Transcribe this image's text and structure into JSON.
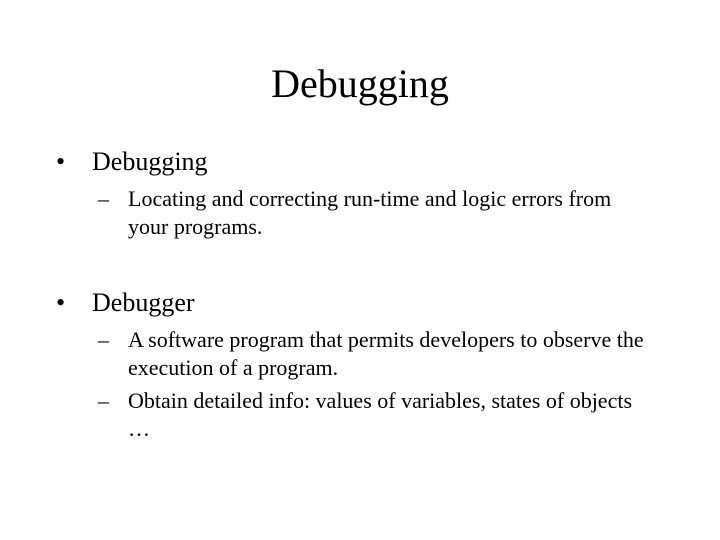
{
  "title": "Debugging",
  "sections": [
    {
      "heading": "Debugging",
      "items": [
        "Locating and correcting run-time and logic errors from your programs."
      ]
    },
    {
      "heading": "Debugger",
      "items": [
        "A software program that permits developers to observe the execution of a program.",
        "Obtain detailed info: values of variables, states of objects …"
      ]
    }
  ]
}
